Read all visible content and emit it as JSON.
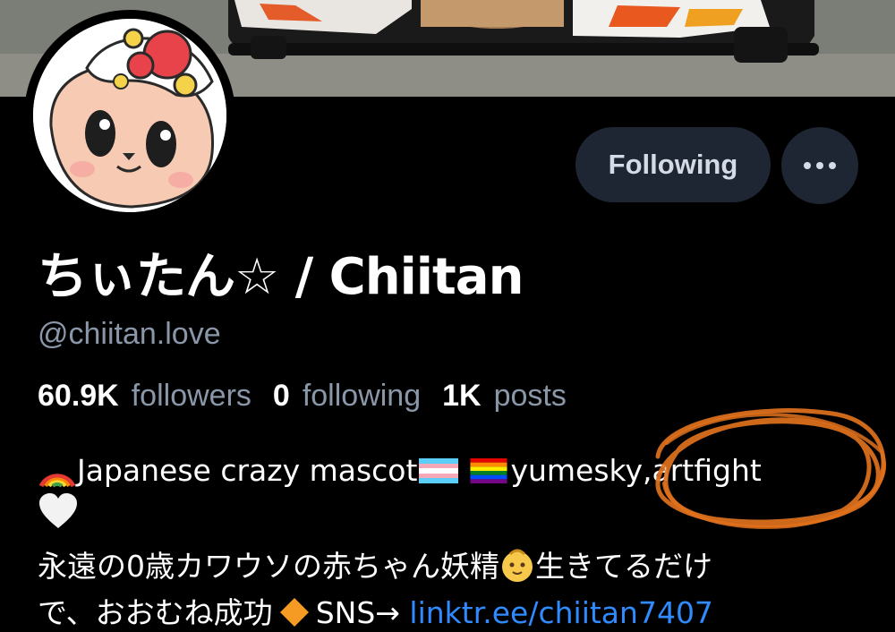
{
  "profile": {
    "display_name": "ちぃたん☆ / Chiitan",
    "handle": "@chiitan.love",
    "stats": {
      "followers_count": "60.9K",
      "followers_label": "followers",
      "following_count": "0",
      "following_label": "following",
      "posts_count": "1K",
      "posts_label": "posts"
    },
    "bio": {
      "line1_a": "Japanese crazy mascot",
      "line1_b": "yumesky,artfight",
      "line3": "永遠の0歳カワウソの赤ちゃん妖精",
      "line3_b": "生きてるだけ",
      "line4_a": "で、おおむね成功",
      "line4_b": "SNS→ ",
      "link": "linktr.ee/chiitan7407"
    }
  },
  "actions": {
    "following_label": "Following",
    "more_icon": "ellipsis-icon"
  },
  "colors": {
    "background": "#000000",
    "button_bg": "#1f2633",
    "muted_text": "#8a97a8",
    "link": "#2f8bff",
    "scribble": "#e0711c"
  }
}
